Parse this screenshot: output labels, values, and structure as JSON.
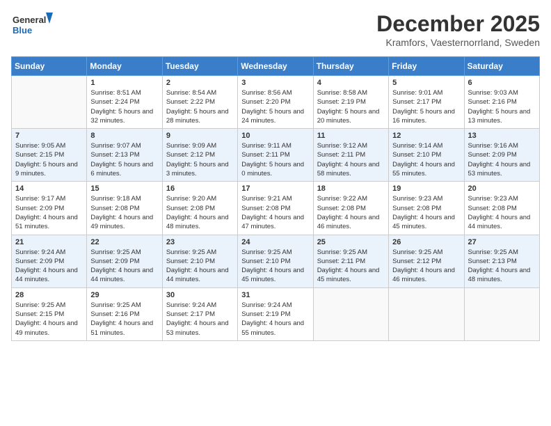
{
  "logo": {
    "line1": "General",
    "line2": "Blue"
  },
  "title": "December 2025",
  "subtitle": "Kramfors, Vaesternorrland, Sweden",
  "headers": [
    "Sunday",
    "Monday",
    "Tuesday",
    "Wednesday",
    "Thursday",
    "Friday",
    "Saturday"
  ],
  "weeks": [
    [
      {
        "num": "",
        "rise": "",
        "set": "",
        "daylight": ""
      },
      {
        "num": "1",
        "rise": "8:51 AM",
        "set": "2:24 PM",
        "daylight": "5 hours and 32 minutes."
      },
      {
        "num": "2",
        "rise": "8:54 AM",
        "set": "2:22 PM",
        "daylight": "5 hours and 28 minutes."
      },
      {
        "num": "3",
        "rise": "8:56 AM",
        "set": "2:20 PM",
        "daylight": "5 hours and 24 minutes."
      },
      {
        "num": "4",
        "rise": "8:58 AM",
        "set": "2:19 PM",
        "daylight": "5 hours and 20 minutes."
      },
      {
        "num": "5",
        "rise": "9:01 AM",
        "set": "2:17 PM",
        "daylight": "5 hours and 16 minutes."
      },
      {
        "num": "6",
        "rise": "9:03 AM",
        "set": "2:16 PM",
        "daylight": "5 hours and 13 minutes."
      }
    ],
    [
      {
        "num": "7",
        "rise": "9:05 AM",
        "set": "2:15 PM",
        "daylight": "5 hours and 9 minutes."
      },
      {
        "num": "8",
        "rise": "9:07 AM",
        "set": "2:13 PM",
        "daylight": "5 hours and 6 minutes."
      },
      {
        "num": "9",
        "rise": "9:09 AM",
        "set": "2:12 PM",
        "daylight": "5 hours and 3 minutes."
      },
      {
        "num": "10",
        "rise": "9:11 AM",
        "set": "2:11 PM",
        "daylight": "5 hours and 0 minutes."
      },
      {
        "num": "11",
        "rise": "9:12 AM",
        "set": "2:11 PM",
        "daylight": "4 hours and 58 minutes."
      },
      {
        "num": "12",
        "rise": "9:14 AM",
        "set": "2:10 PM",
        "daylight": "4 hours and 55 minutes."
      },
      {
        "num": "13",
        "rise": "9:16 AM",
        "set": "2:09 PM",
        "daylight": "4 hours and 53 minutes."
      }
    ],
    [
      {
        "num": "14",
        "rise": "9:17 AM",
        "set": "2:09 PM",
        "daylight": "4 hours and 51 minutes."
      },
      {
        "num": "15",
        "rise": "9:18 AM",
        "set": "2:08 PM",
        "daylight": "4 hours and 49 minutes."
      },
      {
        "num": "16",
        "rise": "9:20 AM",
        "set": "2:08 PM",
        "daylight": "4 hours and 48 minutes."
      },
      {
        "num": "17",
        "rise": "9:21 AM",
        "set": "2:08 PM",
        "daylight": "4 hours and 47 minutes."
      },
      {
        "num": "18",
        "rise": "9:22 AM",
        "set": "2:08 PM",
        "daylight": "4 hours and 46 minutes."
      },
      {
        "num": "19",
        "rise": "9:23 AM",
        "set": "2:08 PM",
        "daylight": "4 hours and 45 minutes."
      },
      {
        "num": "20",
        "rise": "9:23 AM",
        "set": "2:08 PM",
        "daylight": "4 hours and 44 minutes."
      }
    ],
    [
      {
        "num": "21",
        "rise": "9:24 AM",
        "set": "2:09 PM",
        "daylight": "4 hours and 44 minutes."
      },
      {
        "num": "22",
        "rise": "9:25 AM",
        "set": "2:09 PM",
        "daylight": "4 hours and 44 minutes."
      },
      {
        "num": "23",
        "rise": "9:25 AM",
        "set": "2:10 PM",
        "daylight": "4 hours and 44 minutes."
      },
      {
        "num": "24",
        "rise": "9:25 AM",
        "set": "2:10 PM",
        "daylight": "4 hours and 45 minutes."
      },
      {
        "num": "25",
        "rise": "9:25 AM",
        "set": "2:11 PM",
        "daylight": "4 hours and 45 minutes."
      },
      {
        "num": "26",
        "rise": "9:25 AM",
        "set": "2:12 PM",
        "daylight": "4 hours and 46 minutes."
      },
      {
        "num": "27",
        "rise": "9:25 AM",
        "set": "2:13 PM",
        "daylight": "4 hours and 48 minutes."
      }
    ],
    [
      {
        "num": "28",
        "rise": "9:25 AM",
        "set": "2:15 PM",
        "daylight": "4 hours and 49 minutes."
      },
      {
        "num": "29",
        "rise": "9:25 AM",
        "set": "2:16 PM",
        "daylight": "4 hours and 51 minutes."
      },
      {
        "num": "30",
        "rise": "9:24 AM",
        "set": "2:17 PM",
        "daylight": "4 hours and 53 minutes."
      },
      {
        "num": "31",
        "rise": "9:24 AM",
        "set": "2:19 PM",
        "daylight": "4 hours and 55 minutes."
      },
      {
        "num": "",
        "rise": "",
        "set": "",
        "daylight": ""
      },
      {
        "num": "",
        "rise": "",
        "set": "",
        "daylight": ""
      },
      {
        "num": "",
        "rise": "",
        "set": "",
        "daylight": ""
      }
    ]
  ]
}
